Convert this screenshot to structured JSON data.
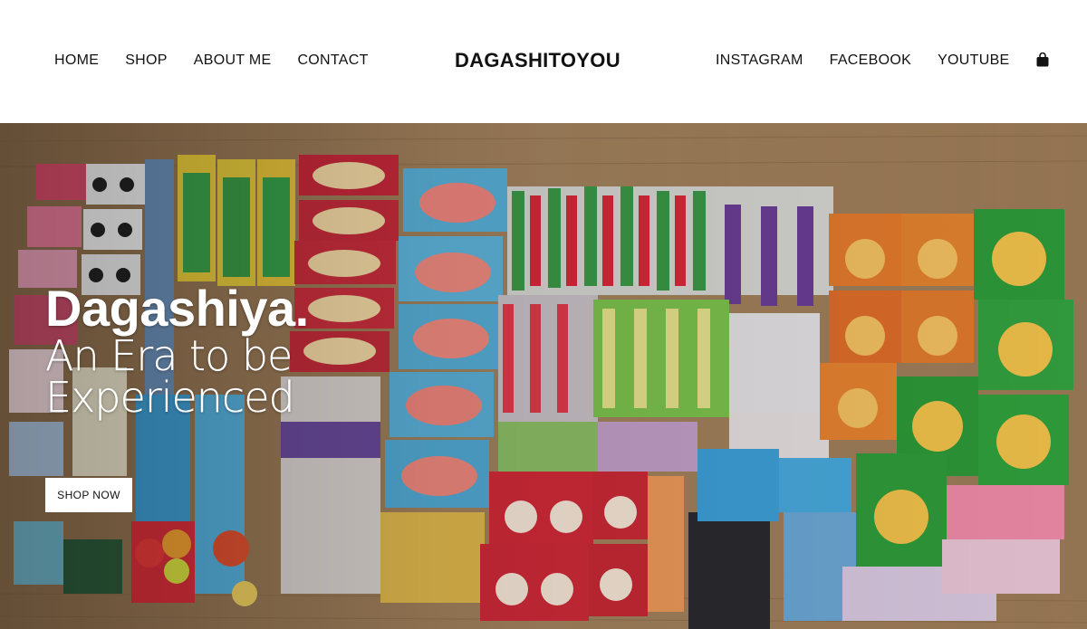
{
  "header": {
    "nav_left": [
      {
        "label": "HOME"
      },
      {
        "label": "SHOP"
      },
      {
        "label": "ABOUT ME"
      },
      {
        "label": "CONTACT"
      }
    ],
    "brand": "DAGASHITOYOU",
    "nav_right": [
      {
        "label": "INSTAGRAM"
      },
      {
        "label": "FACEBOOK"
      },
      {
        "label": "YOUTUBE"
      }
    ],
    "cart_icon": "shopping-bag-icon"
  },
  "hero": {
    "title": "Dagashiya.",
    "subtitle_line1": "An Era to be",
    "subtitle_line2": "Experienced",
    "cta_label": "SHOP NOW",
    "image_description_icon": "candy-assortment-photo",
    "colors": {
      "floor": "#9a7a57",
      "accent_red": "#c8283a",
      "accent_green": "#3f9a3a",
      "accent_yellow": "#e8c23a",
      "accent_blue": "#5aa8d8"
    }
  }
}
